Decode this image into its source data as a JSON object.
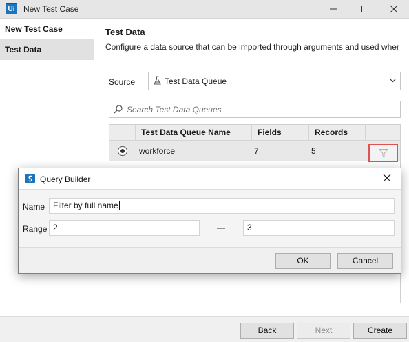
{
  "window": {
    "logo_text": "Ui",
    "title": "New Test Case"
  },
  "sidebar": {
    "items": [
      {
        "label": "New Test Case",
        "selected": false
      },
      {
        "label": "Test Data",
        "selected": true
      }
    ]
  },
  "main": {
    "section_title": "Test Data",
    "section_description": "Configure a data source that can be imported through arguments and used wher",
    "source": {
      "label": "Source",
      "value": "Test Data Queue",
      "icon": "flask-icon"
    },
    "search": {
      "placeholder": "Search Test Data Queues",
      "icon": "search-icon"
    },
    "table": {
      "columns": [
        "",
        "Test Data Queue Name",
        "Fields",
        "Records",
        ""
      ],
      "rows": [
        {
          "selected": true,
          "name": "workforce",
          "fields": "7",
          "records": "5",
          "action_icon": "filter-icon"
        }
      ]
    }
  },
  "footer": {
    "back_label": "Back",
    "next_label": "Next",
    "create_label": "Create",
    "next_disabled": true
  },
  "dialog": {
    "title": "Query Builder",
    "name_label": "Name",
    "name_value": "Filter by full name",
    "range_label": "Range",
    "range_from": "2",
    "range_separator": "—",
    "range_to": "3",
    "ok_label": "OK",
    "cancel_label": "Cancel"
  },
  "colors": {
    "accent": "#1c75bc",
    "highlight_border": "#e05252",
    "selected_row": "#e8e8e8",
    "sidebar_selected": "#e1e1e1"
  }
}
